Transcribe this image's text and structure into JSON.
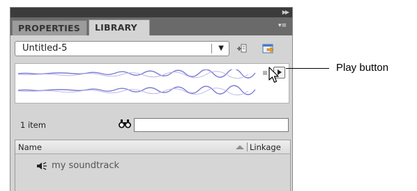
{
  "panel": {
    "tabs": [
      {
        "label": "PROPERTIES",
        "active": false
      },
      {
        "label": "LIBRARY",
        "active": true
      }
    ],
    "collapse_icon": "double-chevron-right-icon",
    "menu_icon": "panel-menu-icon"
  },
  "library": {
    "document_select": {
      "value": "Untitled-5"
    },
    "pin_icon": "pin-library-icon",
    "new_library_icon": "new-library-panel-icon",
    "preview": {
      "stop_icon": "stop-icon",
      "play_icon": "play-icon"
    },
    "item_count": "1 item",
    "search": {
      "icon": "binoculars-icon",
      "value": ""
    },
    "columns": {
      "name": "Name",
      "linkage": "Linkage"
    },
    "items": [
      {
        "icon": "sound-speaker-icon",
        "label": "my soundtrack"
      }
    ]
  },
  "callout": {
    "label": "Play button"
  },
  "colors": {
    "panel_bg": "#d4d4d4",
    "tabbar_bg": "#6a6a6a",
    "waveform": "#6b6bcf"
  }
}
